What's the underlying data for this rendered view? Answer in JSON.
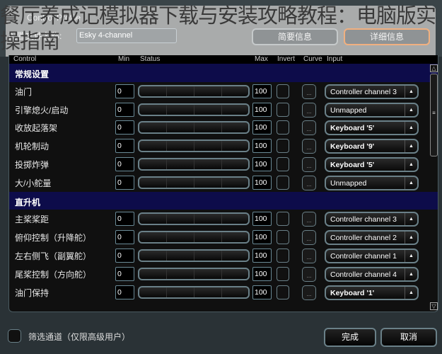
{
  "overlay_title": "餐厅养成记模拟器下载与安装攻略教程：电脑版实操指南",
  "dialog_title": "Control Profile",
  "profile": {
    "label": "配置文件名称:",
    "value": "Esky 4-channel"
  },
  "tabs": [
    {
      "label": "简要信息"
    },
    {
      "label": "详细信息",
      "active": true
    }
  ],
  "columns": [
    "Control",
    "Min",
    "Status",
    "Max",
    "Invert",
    "Curve",
    "Input"
  ],
  "sections": [
    {
      "title": "常规设置",
      "rows": [
        {
          "name": "油门",
          "min": "0",
          "max": "100",
          "input": "Controller channel 3"
        },
        {
          "name": "引擎熄火/启动",
          "min": "0",
          "max": "100",
          "input": "Unmapped"
        },
        {
          "name": "收放起落架",
          "min": "0",
          "max": "100",
          "input": "Keyboard '5'"
        },
        {
          "name": "机轮制动",
          "min": "0",
          "max": "100",
          "input": "Keyboard '9'"
        },
        {
          "name": "投掷炸弹",
          "min": "0",
          "max": "100",
          "input": "Keyboard '5'"
        },
        {
          "name": "大/小舵量",
          "min": "0",
          "max": "100",
          "input": "Unmapped"
        }
      ]
    },
    {
      "title": "直升机",
      "rows": [
        {
          "name": "主桨桨距",
          "min": "0",
          "max": "100",
          "input": "Controller channel 3"
        },
        {
          "name": "俯仰控制（升降舵）",
          "min": "0",
          "max": "100",
          "input": "Controller channel 2"
        },
        {
          "name": "左右侧飞（副翼舵）",
          "min": "0",
          "max": "100",
          "input": "Controller channel 1"
        },
        {
          "name": "尾桨控制（方向舵）",
          "min": "0",
          "max": "100",
          "input": "Controller channel 4"
        },
        {
          "name": "油门保持",
          "min": "0",
          "max": "100",
          "input": "Keyboard '1'"
        }
      ]
    }
  ],
  "curve_label": "...",
  "filter_label": "筛选通道（仅限高级用户）",
  "done_label": "完成",
  "cancel_label": "取消"
}
